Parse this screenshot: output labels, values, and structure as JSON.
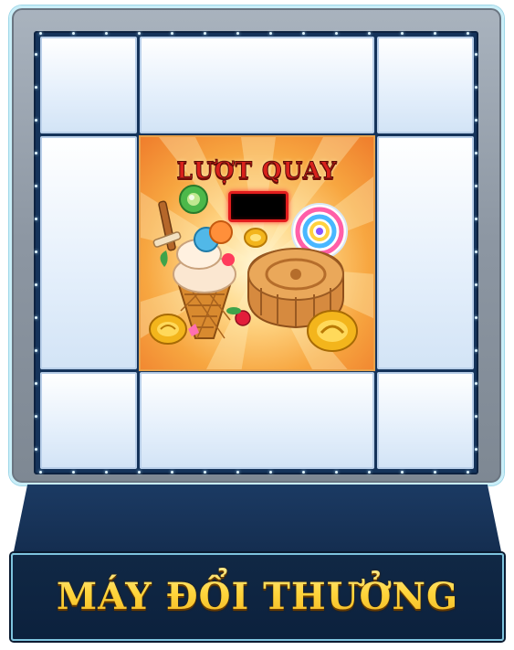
{
  "spin_panel": {
    "title": "LƯỢT QUAY",
    "counter_value": ""
  },
  "machine": {
    "title": "MÁY ĐỔI THƯỞNG"
  },
  "prize_slots": [
    {
      "id": "top-left"
    },
    {
      "id": "top-center"
    },
    {
      "id": "top-right"
    },
    {
      "id": "middle-left"
    },
    {
      "id": "middle-right"
    },
    {
      "id": "bottom-left"
    },
    {
      "id": "bottom-center"
    },
    {
      "id": "bottom-right"
    }
  ],
  "icons": [
    "ice-cream-icon",
    "mooncake-icon",
    "lollipop-icon",
    "gold-coin-icon",
    "candy-icon"
  ],
  "colors": {
    "frame": "#8c96a2",
    "grid_panel": "#15335a",
    "slot": "#e4effb",
    "title_red": "#d8211c",
    "gold": "#ffd84a",
    "base": "#142d4f"
  }
}
